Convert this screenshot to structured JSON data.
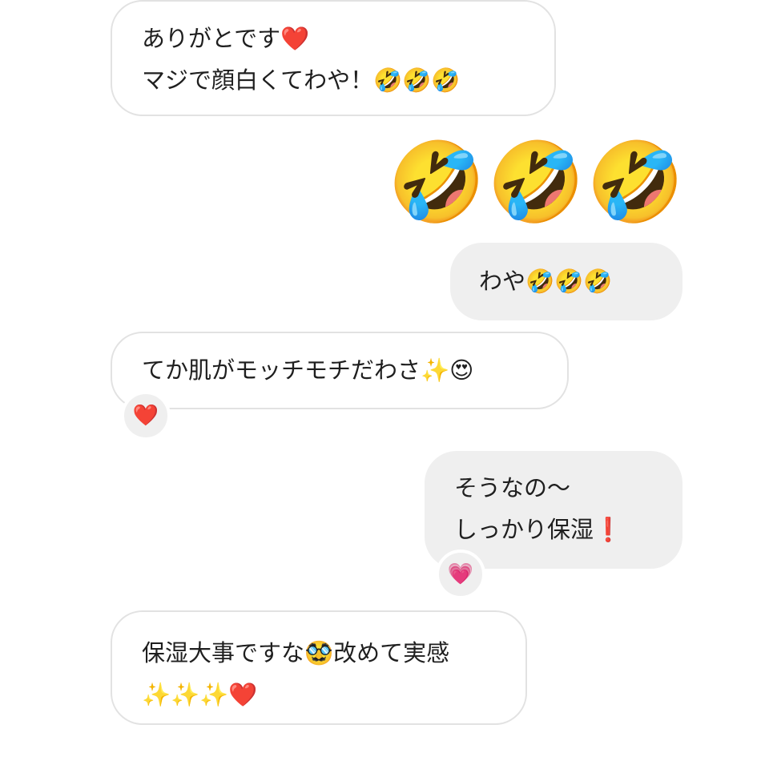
{
  "messages": [
    {
      "id": "msg1",
      "direction": "incoming",
      "lines": [
        "ありがとです❤️",
        "マジで顔白くてわや！🤣🤣🤣"
      ]
    },
    {
      "id": "msg2",
      "direction": "outgoing",
      "big_emoji": "🤣🤣🤣"
    },
    {
      "id": "msg3",
      "direction": "outgoing",
      "lines": [
        "わや🤣🤣🤣"
      ]
    },
    {
      "id": "msg4",
      "direction": "incoming",
      "lines": [
        "てか肌がモッチモチだわさ✨😍"
      ],
      "reaction": "❤️"
    },
    {
      "id": "msg5",
      "direction": "outgoing",
      "lines": [
        "そうなの〜",
        "しっかり保湿❗️"
      ],
      "reaction": "💗"
    },
    {
      "id": "msg6",
      "direction": "incoming",
      "lines": [
        "保湿大事ですな🥸改めて実感",
        "✨✨✨❤️"
      ]
    }
  ],
  "colors": {
    "incoming_bubble_bg": "#ffffff",
    "incoming_bubble_border": "#e2e2e2",
    "outgoing_bubble_bg": "#efefef",
    "text": "#1f1f1f"
  }
}
